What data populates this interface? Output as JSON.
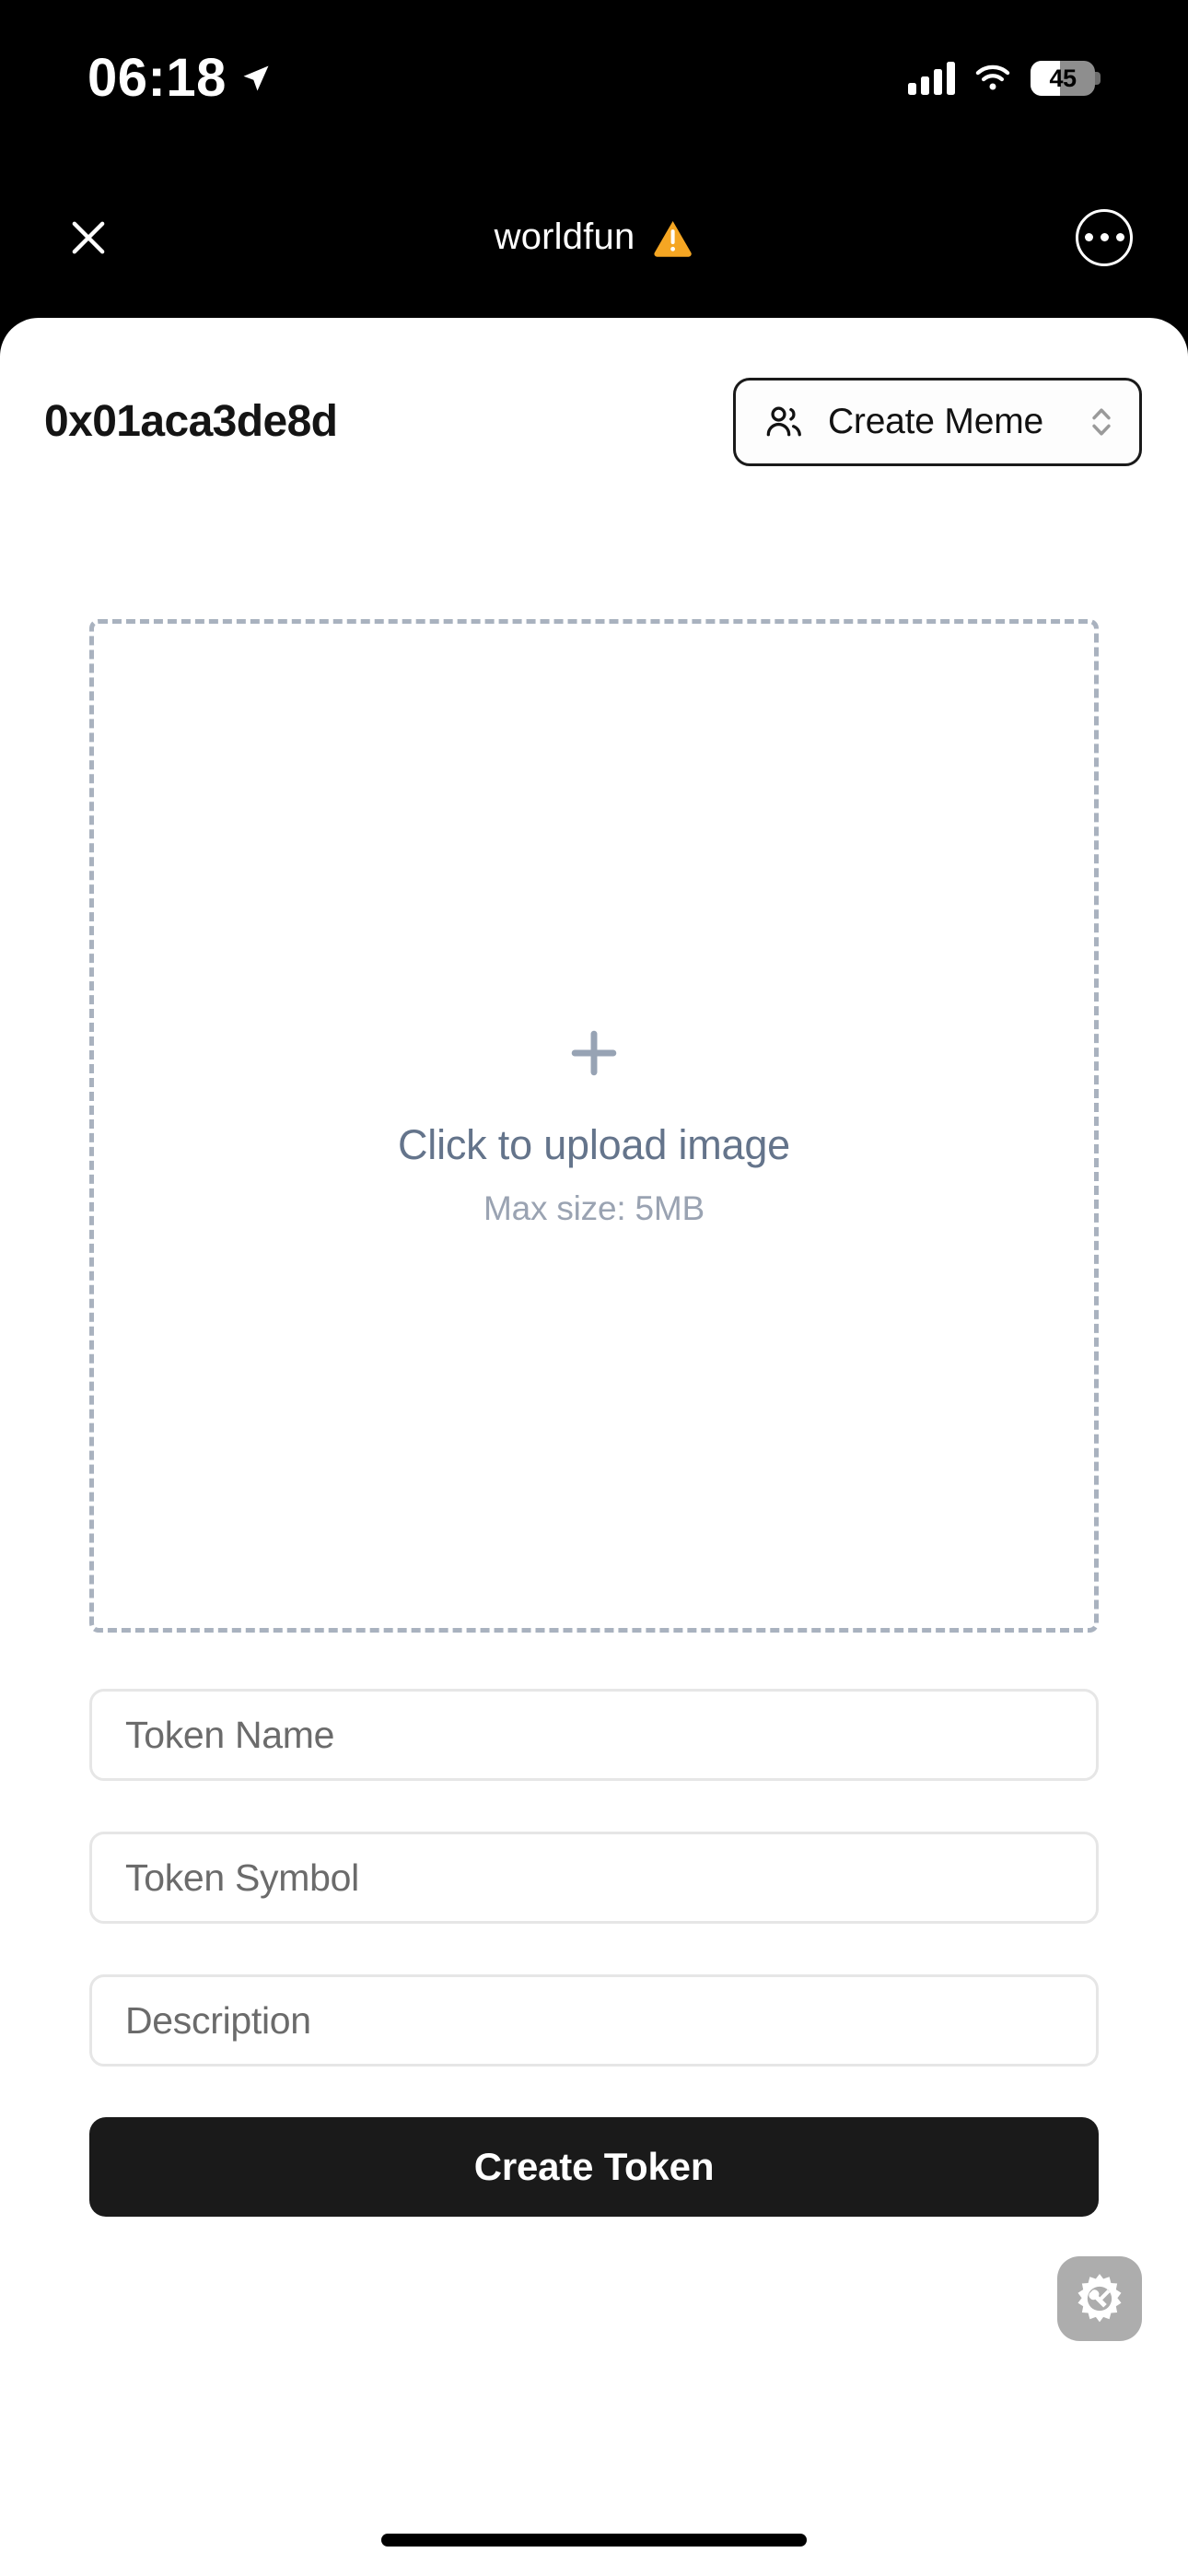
{
  "status_bar": {
    "time": "06:18",
    "location_icon": "location-arrow-icon",
    "signal_icon": "cellular-signal-icon",
    "wifi_icon": "wifi-icon",
    "battery_percent": "45",
    "battery_level": 45
  },
  "browser_header": {
    "close_icon": "close-icon",
    "site_title": "worldfun",
    "warning_icon": "warning-triangle-icon",
    "warning_color": "#F5A623",
    "more_icon": "more-options-icon"
  },
  "site_bar": {
    "wallet_address": "0x01aca3de8d",
    "mode": {
      "icon": "users-icon",
      "label": "Create Meme",
      "chevron_icon": "chevron-up-down-icon",
      "options": [
        "Create Meme"
      ]
    }
  },
  "upload": {
    "plus_icon": "plus-icon",
    "title": "Click to upload image",
    "subtitle": "Max size: 5MB",
    "border_color": "#a9b2bf"
  },
  "form": {
    "fields": [
      {
        "name": "token-name",
        "placeholder": "Token Name",
        "value": ""
      },
      {
        "name": "token-symbol",
        "placeholder": "Token Symbol",
        "value": ""
      },
      {
        "name": "description",
        "placeholder": "Description",
        "value": ""
      }
    ],
    "submit_label": "Create Token",
    "submit_color": "#1a1a1a"
  },
  "floating_button": {
    "icon": "gear-tools-icon",
    "background": "#adadad"
  },
  "home_indicator": {
    "visible": true
  }
}
